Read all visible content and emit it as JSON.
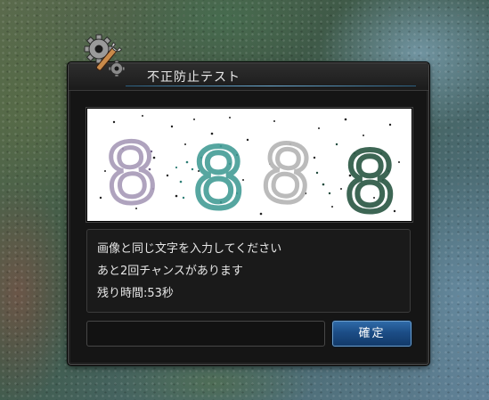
{
  "dialog": {
    "title": "不正防止テスト",
    "captcha": {
      "digits": [
        "8",
        "8",
        "8",
        "8"
      ]
    },
    "messages": {
      "line1": "画像と同じ文字を入力してください",
      "line2": "あと2回チャンスがあります",
      "line3": "残り時間:53秒"
    },
    "answer_value": "",
    "confirm_label": "確定",
    "icon": "wrench-gear-icon"
  },
  "colors": {
    "accent": "#6fb0d8",
    "button": "#1c4d86",
    "panel": "#151515"
  }
}
